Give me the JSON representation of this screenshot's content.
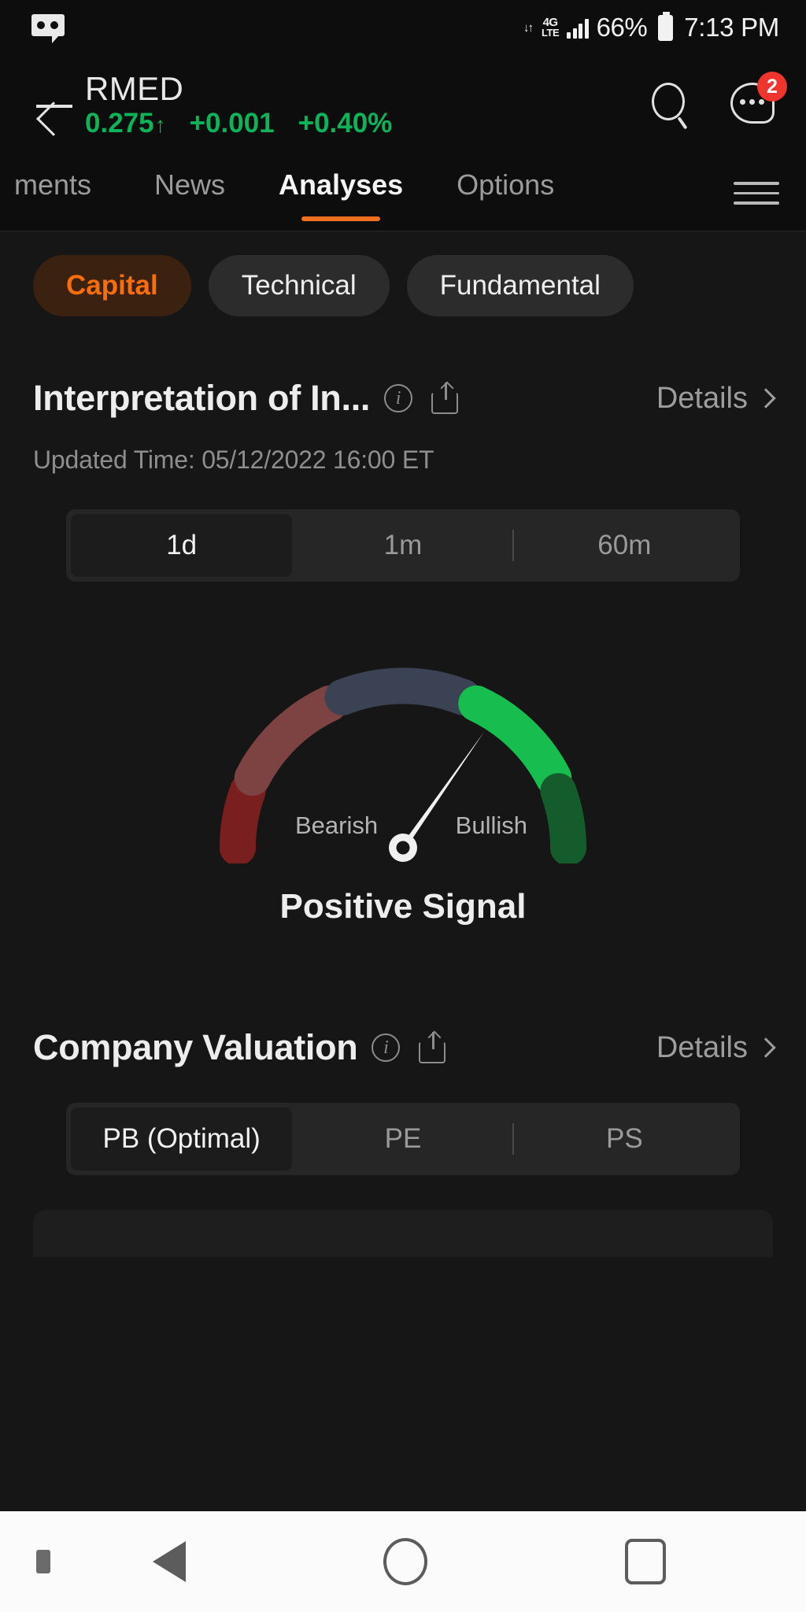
{
  "statusbar": {
    "voicemail_icon": "voicemail-icon",
    "network_type": "4G",
    "network_sub": "LTE",
    "data_arrows": "↓↑",
    "battery_percent": "66%",
    "clock": "7:13 PM"
  },
  "header": {
    "back_icon": "back-arrow-icon",
    "ticker": "RMED",
    "price": "0.275",
    "price_arrow": "↑",
    "change": "+0.001",
    "change_pct": "+0.40%",
    "up_color": "#0db359",
    "search_icon": "search-icon",
    "chat_icon": "chat-icon",
    "chat_badge": "2",
    "badge_color": "#f0352e"
  },
  "tabs": {
    "items": [
      {
        "label": "ments",
        "active": false
      },
      {
        "label": "News",
        "active": false
      },
      {
        "label": "Analyses",
        "active": true
      },
      {
        "label": "Options",
        "active": false
      }
    ],
    "menu_icon": "hamburger-menu-icon",
    "accent": "#f07021"
  },
  "chips": {
    "items": [
      {
        "label": "Capital",
        "active": true
      },
      {
        "label": "Technical",
        "active": false
      },
      {
        "label": "Fundamental",
        "active": false
      }
    ],
    "active_text_color": "#f96e0b",
    "active_bg_color": "#3a2110"
  },
  "interpretation": {
    "title": "Interpretation of In...",
    "info_icon": "info-icon",
    "share_icon": "share-icon",
    "details_label": "Details",
    "chevron_icon": "chevron-right-icon",
    "updated_time": "Updated Time: 05/12/2022 16:00 ET",
    "periods": [
      {
        "label": "1d",
        "active": true
      },
      {
        "label": "1m",
        "active": false
      },
      {
        "label": "60m",
        "active": false
      }
    ]
  },
  "gauge": {
    "left_label": "Bearish",
    "right_label": "Bullish",
    "signal": "Positive Signal",
    "needle_angle_deg": 35,
    "segments": [
      {
        "name": "strong-bearish",
        "color": "#7a1f1f"
      },
      {
        "name": "bearish",
        "color": "#7d4343"
      },
      {
        "name": "neutral",
        "color": "#3a4253"
      },
      {
        "name": "bullish",
        "color": "#17bd4e"
      },
      {
        "name": "strong-bullish",
        "color": "#145c2b"
      }
    ]
  },
  "valuation": {
    "title": "Company Valuation",
    "info_icon": "info-icon",
    "share_icon": "share-icon",
    "details_label": "Details",
    "chevron_icon": "chevron-right-icon",
    "metrics": [
      {
        "label": "PB (Optimal)",
        "active": true
      },
      {
        "label": "PE",
        "active": false
      },
      {
        "label": "PS",
        "active": false
      }
    ]
  },
  "navbar": {
    "dot_icon": "nav-dot-icon",
    "back_icon": "nav-back-icon",
    "home_icon": "nav-home-icon",
    "recents_icon": "nav-recents-icon"
  }
}
